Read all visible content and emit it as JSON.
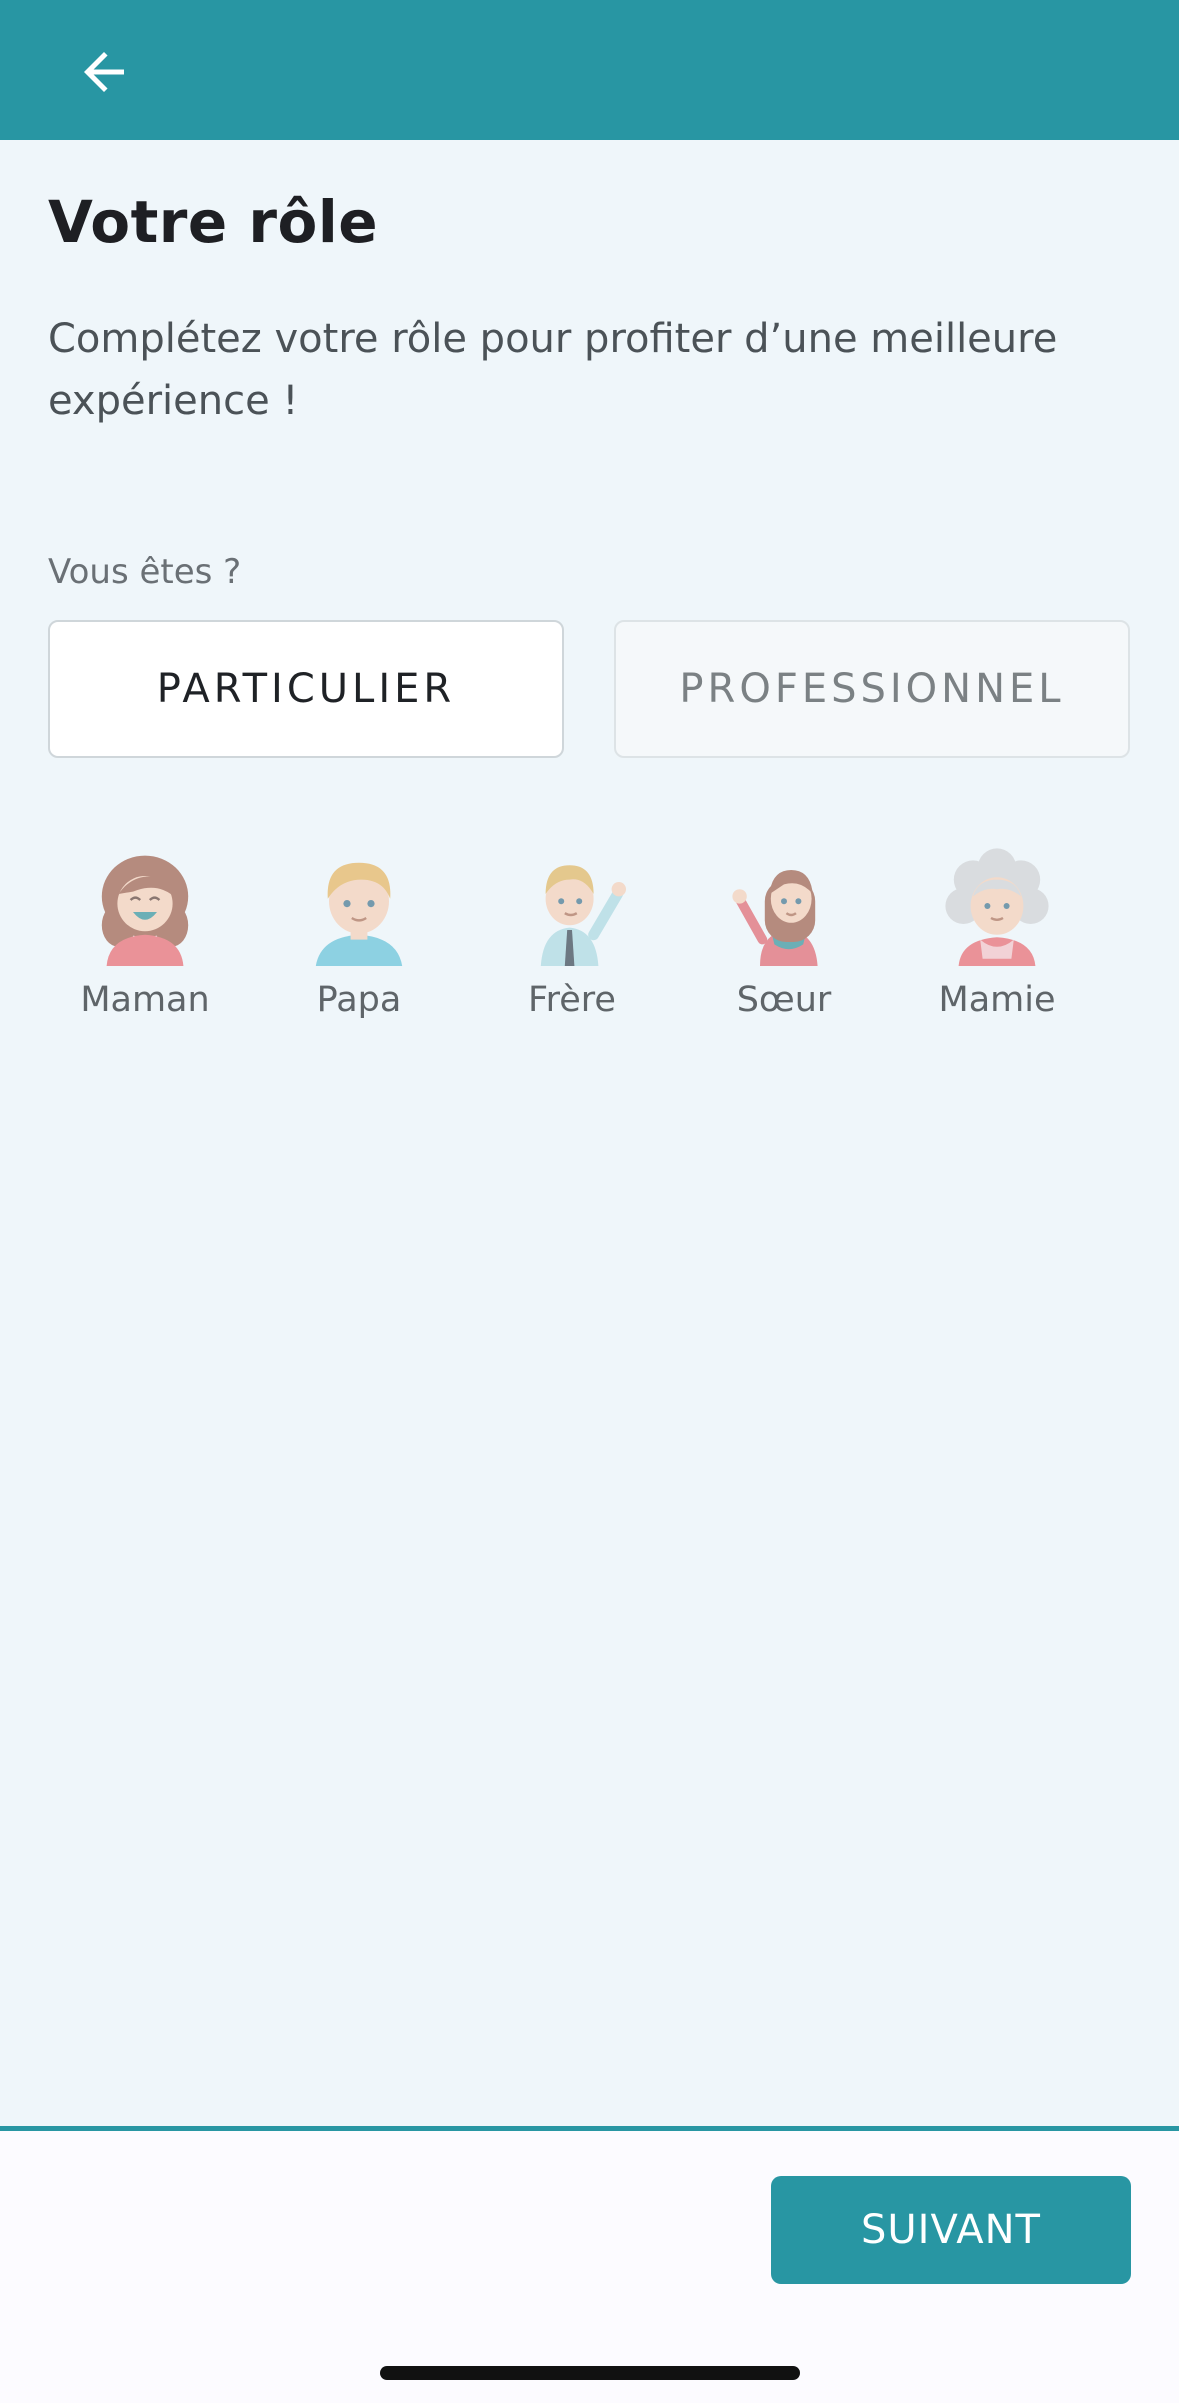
{
  "header": {
    "back_icon": "arrow-left-icon",
    "background": "#2896a3"
  },
  "main": {
    "title": "Votre rôle",
    "subtitle": "Complétez votre rôle pour profiter d’une meilleure expérience !",
    "question": "Vous êtes ?",
    "toggle": {
      "particulier": "PARTICULIER",
      "professionnel": "PROFESSIONNEL",
      "selected": "PARTICULIER"
    },
    "roles": [
      {
        "label": "Maman",
        "icon": "mom-avatar-icon"
      },
      {
        "label": "Papa",
        "icon": "dad-avatar-icon"
      },
      {
        "label": "Frère",
        "icon": "brother-avatar-icon"
      },
      {
        "label": "Sœur",
        "icon": "sister-avatar-icon"
      },
      {
        "label": "Mamie",
        "icon": "grandma-avatar-icon"
      }
    ]
  },
  "footer": {
    "next_label": "SUIVANT"
  },
  "colors": {
    "accent": "#2896a3",
    "background": "#eff6fa"
  }
}
